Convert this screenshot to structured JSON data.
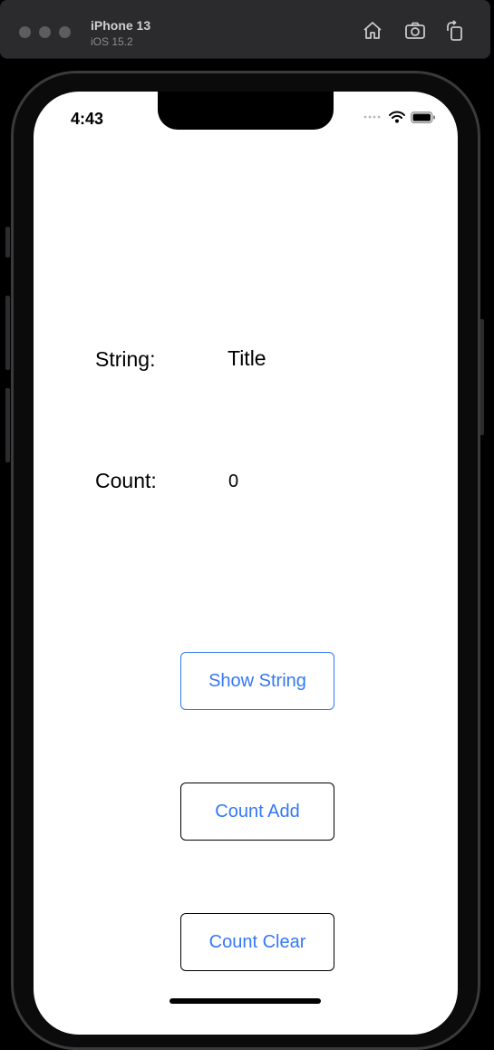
{
  "simulator": {
    "device_name": "iPhone 13",
    "os_version": "iOS 15.2"
  },
  "status_bar": {
    "time": "4:43"
  },
  "content": {
    "string_label": "String:",
    "string_value": "Title",
    "count_label": "Count:",
    "count_value": "0"
  },
  "buttons": {
    "show_string": "Show String",
    "count_add": "Count Add",
    "count_clear": "Count Clear"
  },
  "colors": {
    "accent": "#3478f6",
    "focused_border": "#3478f6",
    "button_border": "#000000"
  }
}
